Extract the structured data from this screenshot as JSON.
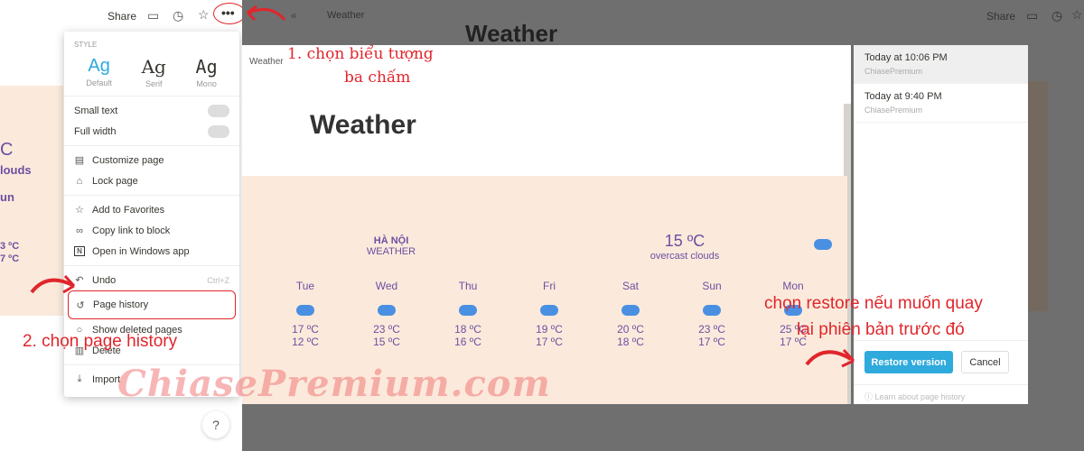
{
  "left": {
    "share": "Share",
    "partial_temp": "C",
    "partial_desc": "louds",
    "partial_day": "un",
    "partial_hi": "3 ºC",
    "partial_lo": "7 ºC",
    "help": "?"
  },
  "menu": {
    "style_label": "STYLE",
    "fonts": [
      {
        "ag": "Ag",
        "label": "Default"
      },
      {
        "ag": "Ag",
        "label": "Serif"
      },
      {
        "ag": "Ag",
        "label": "Mono"
      }
    ],
    "toggles": [
      {
        "label": "Small text",
        "on": false
      },
      {
        "label": "Full width",
        "on": false
      }
    ],
    "group1": [
      "Customize page",
      "Lock page"
    ],
    "group2": [
      "Add to Favorites",
      "Copy link to block",
      "Open in Windows app"
    ],
    "undo": "Undo",
    "undo_shortcut": "Ctrl+Z",
    "page_history": "Page history",
    "show_deleted": "Show deleted pages",
    "delete": "Delete",
    "import": "Import"
  },
  "bg": {
    "breadcrumb": "Weather",
    "share": "Share",
    "title_peek": "Weather"
  },
  "preview": {
    "breadcrumb": "Weather",
    "title": "Weather",
    "city": "HÀ NỘI",
    "city_sub": "WEATHER",
    "temp": "15 ºC",
    "desc": "overcast clouds",
    "days": [
      {
        "d": "Tue",
        "hi": "17 ºC",
        "lo": "12 ºC"
      },
      {
        "d": "Wed",
        "hi": "23 ºC",
        "lo": "15 ºC"
      },
      {
        "d": "Thu",
        "hi": "18 ºC",
        "lo": "16 ºC"
      },
      {
        "d": "Fri",
        "hi": "19 ºC",
        "lo": "17 ºC"
      },
      {
        "d": "Sat",
        "hi": "20 ºC",
        "lo": "18 ºC"
      },
      {
        "d": "Sun",
        "hi": "23 ºC",
        "lo": "17 ºC"
      },
      {
        "d": "Mon",
        "hi": "25 ºC",
        "lo": "17 ºC"
      }
    ]
  },
  "history": {
    "versions": [
      {
        "time": "Today at 10:06 PM",
        "user": "ChiasePremium",
        "selected": true
      },
      {
        "time": "Today at 9:40 PM",
        "user": "ChiasePremium",
        "selected": false
      }
    ],
    "restore": "Restore version",
    "cancel": "Cancel",
    "learn": "Learn about page history",
    "accent": "#2eaadc"
  },
  "annotations": {
    "step1_a": "1. chọn biểu tượng",
    "step1_b": "ba chấm",
    "step2": "2. chọn page history",
    "step3_a": "chọn restore nếu muốn quay",
    "step3_b": "lại phiên bản trước đó"
  },
  "watermark": "ChiasePremium.com"
}
